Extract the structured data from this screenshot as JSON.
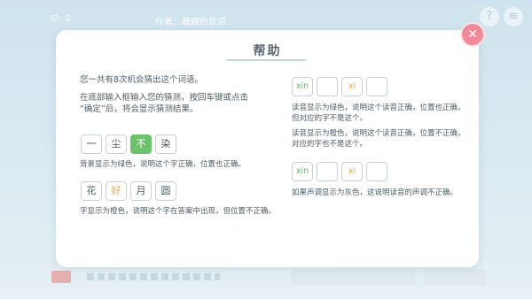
{
  "background": {
    "id_label": "ID: 0",
    "author_label": "作者：藏藏的思语",
    "help_button": "?",
    "menu_button": "≡"
  },
  "dialog": {
    "title": "帮助",
    "close_label": "✕",
    "intro": {
      "line1": "您一共有8次机会猜出这个词语。",
      "line2": "在底部输入框输入您的猜测，按回车键或点击",
      "line3": "“确定”后，将会显示猜测结果。"
    },
    "example1": {
      "chars": [
        "一",
        "尘",
        "不",
        "染"
      ],
      "caption": "背景显示为绿色，说明这个字正确，位置也正确。"
    },
    "example2": {
      "chars": [
        "花",
        "好",
        "月",
        "圆"
      ],
      "caption": "字显示为橙色，说明这个字在答案中出现，但位置不正确。"
    },
    "pinyin1": {
      "cells": [
        "xin",
        "",
        "xi",
        ""
      ],
      "caption1_line1": "读音显示为绿色，说明这个读音正确，位置也正确，",
      "caption1_line2": "但对应的字不是这个。",
      "caption2_line1": "读音显示为橙色，说明这个读音正确，位置不正确，",
      "caption2_line2": "对应的字也不是这个。"
    },
    "pinyin2": {
      "cells": [
        "xin",
        "",
        "xi",
        ""
      ],
      "caption": "如果声调显示为灰色，这说明读音的声调不正确。"
    },
    "colors": {
      "correct": "#6cc26c",
      "present": "#f0a33f",
      "close_button": "#f08a9b"
    }
  }
}
